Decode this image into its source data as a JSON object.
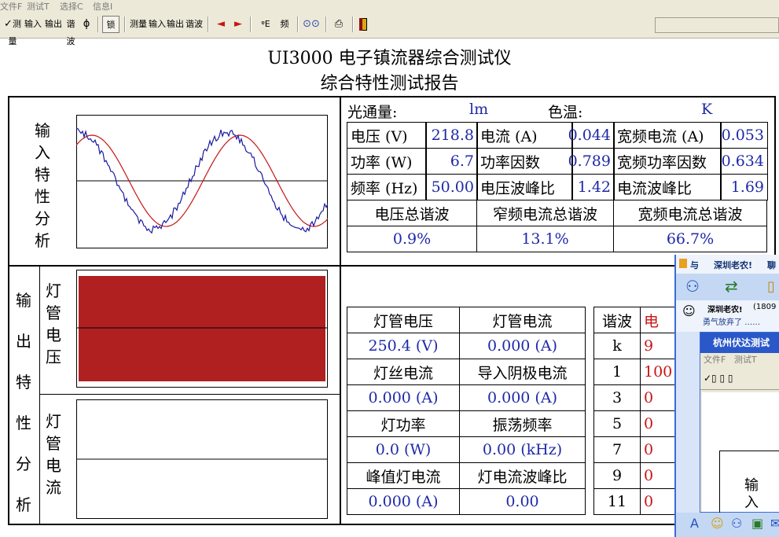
{
  "menu": [
    "文件F",
    "测试T",
    "选择C",
    "信息I"
  ],
  "toolbar": {
    "groups": [
      {
        "items": [
          "测量",
          "输入",
          "输出",
          "谐波"
        ],
        "icons": [
          "measure-icon",
          "input-icon",
          "output-icon",
          "harmonic-icon"
        ]
      },
      {
        "items": [
          "锁"
        ],
        "icons": [
          "lock-icon"
        ]
      },
      {
        "items": [
          "测量",
          "输入",
          "输出",
          "谐波"
        ],
        "icons": [
          "measure2-icon",
          "input2-icon",
          "output2-icon",
          "harmonic2-icon"
        ]
      },
      {
        "items": [
          "◄",
          "►",
          "频"
        ],
        "icons": [
          "arrow-left-icon",
          "arrow-right-icon",
          "frequency-icon"
        ]
      }
    ],
    "extra_icons": [
      "binoculars-icon",
      "printer-icon",
      "exit-icon"
    ]
  },
  "title1": "UI3000 电子镇流器综合测试仪",
  "title2": "综合特性测试报告",
  "input_section": {
    "label_chars": [
      "输",
      "入",
      "特",
      "性",
      "分",
      "析"
    ]
  },
  "output_section": {
    "label_chars": [
      "输",
      "出",
      "特",
      "性",
      "分",
      "析"
    ],
    "voltage_chars": [
      "灯",
      "管",
      "电",
      "压"
    ],
    "current_chars": [
      "灯",
      "管",
      "电",
      "流"
    ]
  },
  "photometric": {
    "flux_label": "光通量:",
    "flux_unit": "lm",
    "temp_label": "色温:",
    "temp_unit": "K"
  },
  "input_table": {
    "rows": [
      [
        {
          "label": "电压 (V)",
          "value": "218.8"
        },
        {
          "label": "电流 (A)",
          "value": "0.044"
        },
        {
          "label": "宽频电流 (A)",
          "value": "0.053"
        }
      ],
      [
        {
          "label": "功率 (W)",
          "value": "6.7"
        },
        {
          "label": "功率因数",
          "value": "0.789"
        },
        {
          "label": "宽频功率因数",
          "value": "0.634"
        }
      ],
      [
        {
          "label": "频率 (Hz)",
          "value": "50.00"
        },
        {
          "label": "电压波峰比",
          "value": "1.42"
        },
        {
          "label": "电流波峰比",
          "value": "1.69"
        }
      ]
    ],
    "thd_headers": [
      "电压总谐波",
      "窄频电流总谐波",
      "宽频电流总谐波"
    ],
    "thd_values": [
      "0.9%",
      "13.1%",
      "66.7%"
    ]
  },
  "lamp_table": {
    "rows": [
      [
        "灯管电压",
        "灯管电流"
      ],
      [
        "250.4 (V)",
        "0.000 (A)"
      ],
      [
        "灯丝电流",
        "导入阴极电流"
      ],
      [
        "0.000 (A)",
        "0.000 (A)"
      ],
      [
        "灯功率",
        "振荡频率"
      ],
      [
        "0.0 (W)",
        "0.00 (kHz)"
      ],
      [
        "峰值灯电流",
        "灯电流波峰比"
      ],
      [
        "0.000 (A)",
        "0.00"
      ]
    ]
  },
  "harmonic_table": {
    "header": "谐波",
    "header2": "电",
    "k": [
      "k",
      "1",
      "3",
      "5",
      "7",
      "9",
      "11"
    ],
    "values": [
      "9",
      "100",
      "0",
      "0",
      "0",
      "0",
      "0"
    ]
  },
  "popup": {
    "title": "与",
    "contact_title": "深圳老农!",
    "contact_short": "聊",
    "contact_name": "深圳老农!",
    "contact_id": "(1809",
    "status_text": "勇气放弃了 ……",
    "inner_title": "杭州伏达测试",
    "inner_menu": [
      "文件F",
      "测试T"
    ],
    "inner_chars": [
      "输",
      "入"
    ]
  },
  "colors": {
    "accent_blue": "#1f28a8",
    "trace_red": "#c81414",
    "trace_blue": "#1a1aa0",
    "chrome": "#ece9d8"
  }
}
